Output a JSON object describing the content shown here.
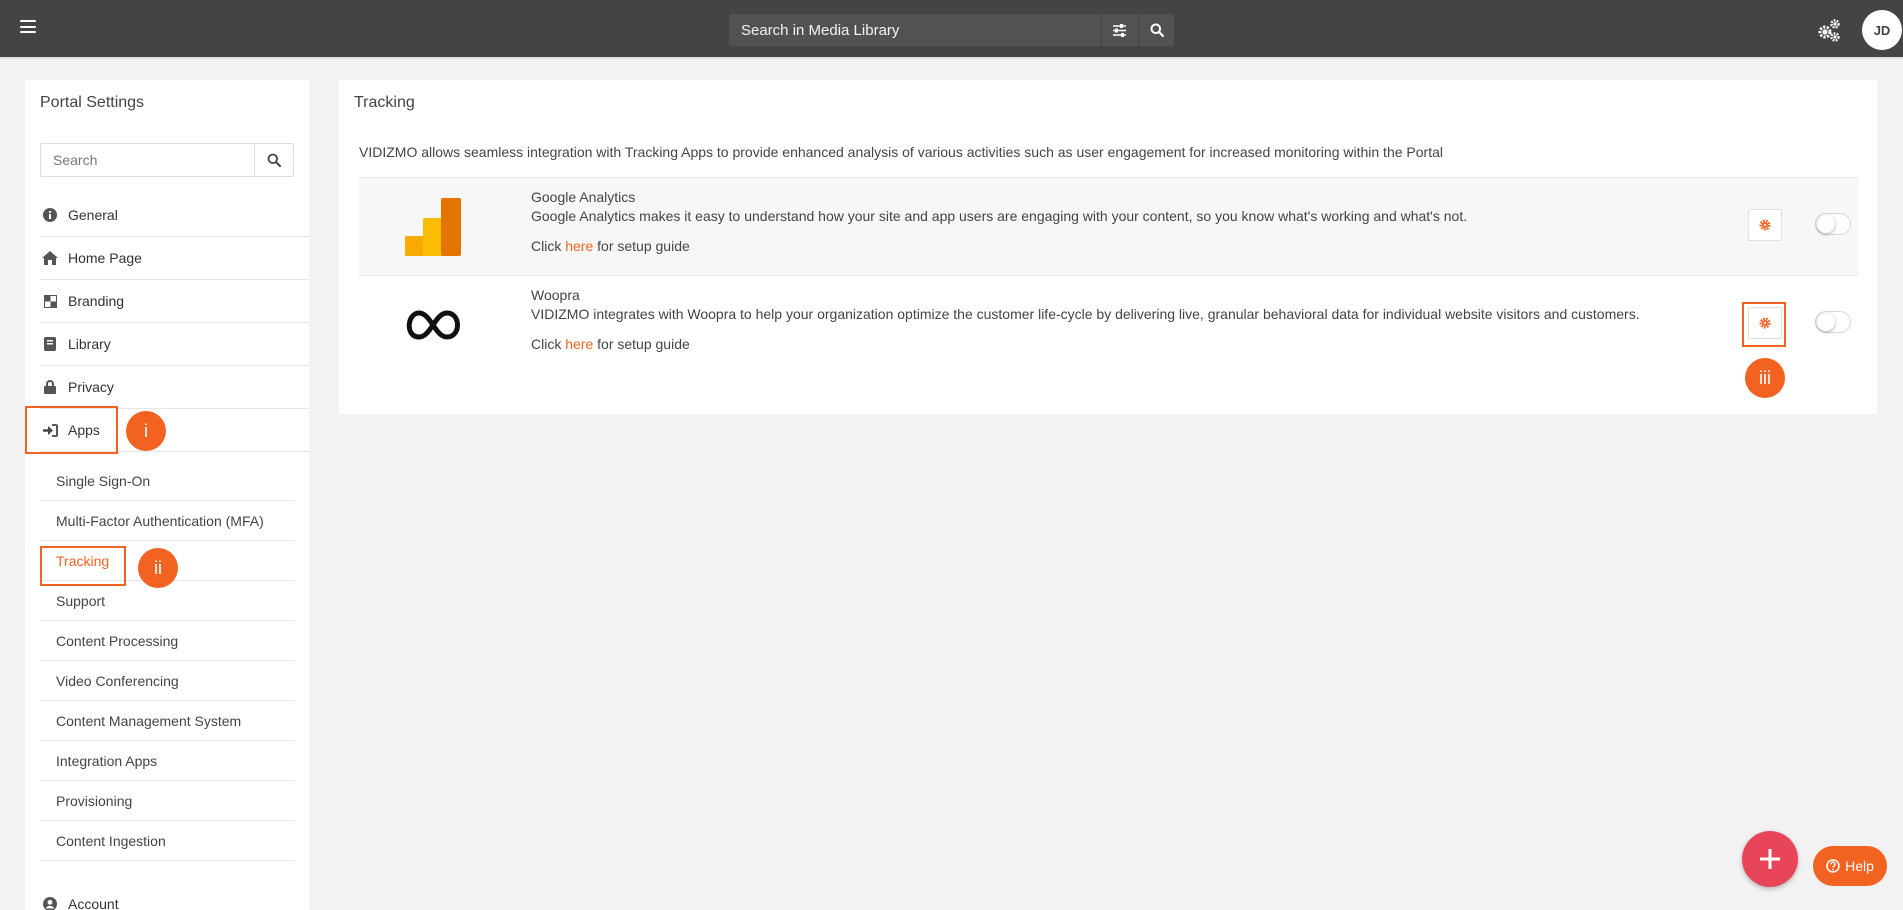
{
  "topbar": {
    "search_placeholder": "Search in Media Library",
    "avatar_initials": "JD"
  },
  "sidebar": {
    "title": "Portal Settings",
    "search_placeholder": "Search",
    "items": [
      {
        "label": "General",
        "icon": "info-circle-icon"
      },
      {
        "label": "Home Page",
        "icon": "home-icon"
      },
      {
        "label": "Branding",
        "icon": "branding-icon"
      },
      {
        "label": "Library",
        "icon": "book-icon"
      },
      {
        "label": "Privacy",
        "icon": "lock-icon"
      },
      {
        "label": "Apps",
        "icon": "sign-in-icon"
      },
      {
        "label": "Account",
        "icon": "user-circle-icon"
      }
    ],
    "sub_items": [
      {
        "label": "Single Sign-On"
      },
      {
        "label": "Multi-Factor Authentication (MFA)"
      },
      {
        "label": "Tracking"
      },
      {
        "label": "Support"
      },
      {
        "label": "Content Processing"
      },
      {
        "label": "Video Conferencing"
      },
      {
        "label": "Content Management System"
      },
      {
        "label": "Integration Apps"
      },
      {
        "label": "Provisioning"
      },
      {
        "label": "Content Ingestion"
      }
    ],
    "active_sub_item": "Tracking"
  },
  "annotations": {
    "badge_1": "i",
    "badge_2": "ii",
    "badge_3": "iii"
  },
  "main": {
    "title": "Tracking",
    "intro": "VIDIZMO allows seamless integration with Tracking Apps to provide enhanced analysis of various activities such as user engagement for increased monitoring within the Portal",
    "apps": [
      {
        "name": "Google Analytics",
        "description": "Google Analytics makes it easy to understand how your site and app users are engaging with your content, so you know what's working and what's not.",
        "guide_prefix": "Click ",
        "guide_link": "here",
        "guide_suffix": " for setup guide",
        "enabled": false
      },
      {
        "name": "Woopra",
        "description": "VIDIZMO integrates with Woopra to help your organization optimize the customer life-cycle by delivering live, granular behavioral data for individual website visitors and customers.",
        "guide_prefix": "Click ",
        "guide_link": "here",
        "guide_suffix": " for setup guide",
        "enabled": false
      }
    ]
  },
  "floating": {
    "help_label": "Help"
  },
  "colors": {
    "accent": "#f26322",
    "topbar": "#444444",
    "fab": "#e8445a"
  }
}
